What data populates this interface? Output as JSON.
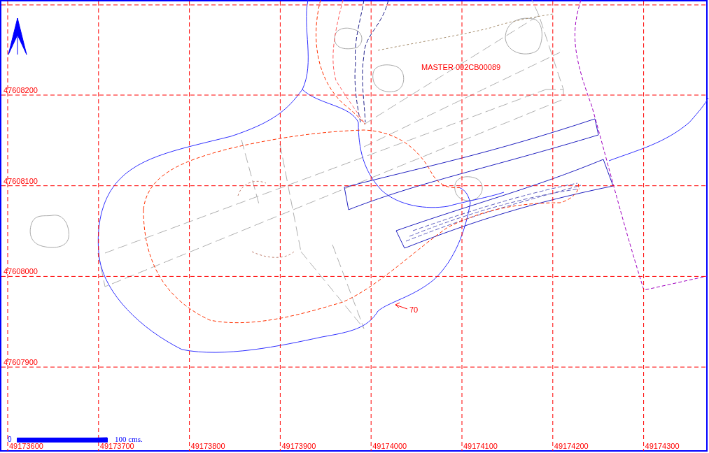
{
  "map": {
    "northings": [
      "47608200",
      "47608100",
      "47608000",
      "47607900"
    ],
    "eastings": [
      "49173600",
      "49173700",
      "49173800",
      "49173900",
      "49174000",
      "49174100",
      "49174200",
      "49174300"
    ],
    "sheet_label": "MASTER 002CB00089",
    "contour_label": "70",
    "scale_bar": {
      "start": "0",
      "end": "100 cms."
    }
  }
}
